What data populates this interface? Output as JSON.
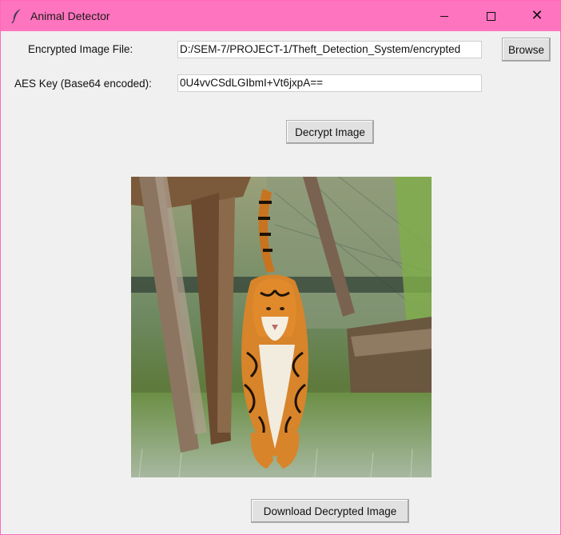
{
  "window": {
    "title": "Animal Detector"
  },
  "form": {
    "file_label": "Encrypted Image File:",
    "file_value": "D:/SEM-7/PROJECT-1/Theft_Detection_System/encrypted",
    "browse_label": "Browse",
    "key_label": "AES Key (Base64 encoded):",
    "key_value": "0U4vvCSdLGIbmI+Vt6jxpA==",
    "decrypt_label": "Decrypt Image"
  },
  "image": {
    "subject": "tiger"
  },
  "footer": {
    "download_label": "Download Decrypted Image"
  },
  "icons": {
    "app": "feather-icon",
    "minimize": "minimize-icon",
    "maximize": "maximize-icon",
    "close": "close-icon"
  },
  "colors": {
    "titlebar": "#ff74bf",
    "background": "#f0f0f0"
  }
}
